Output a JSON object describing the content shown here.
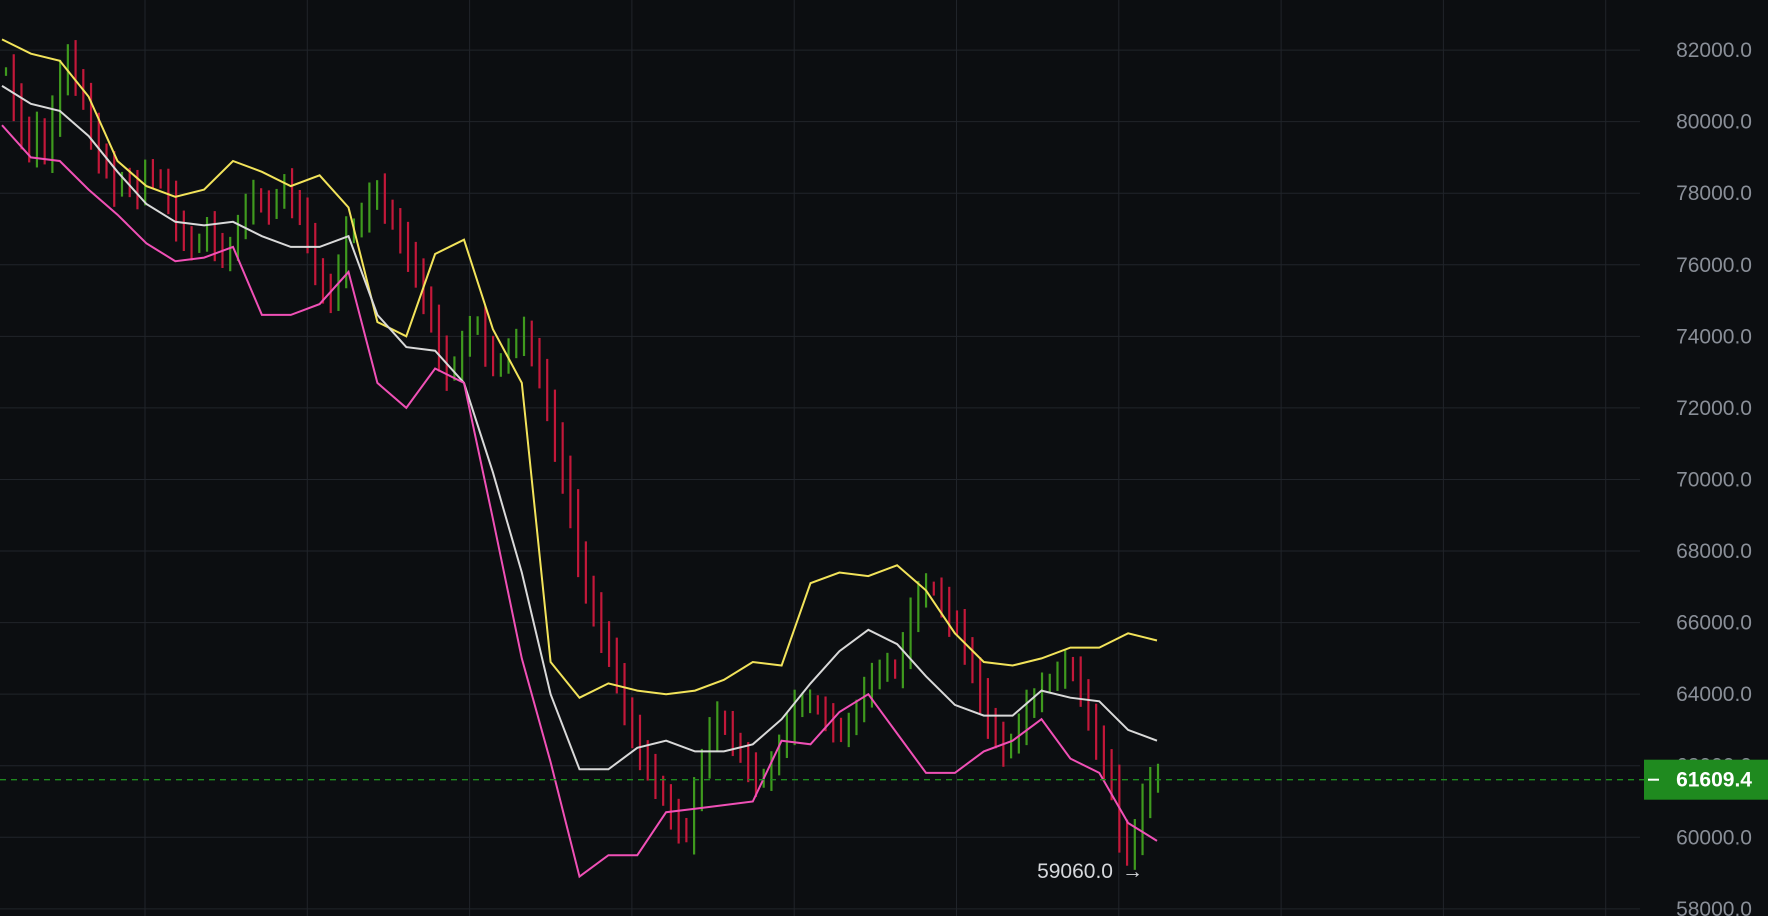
{
  "chart_data": {
    "type": "line",
    "subtype": "ohlc-bars-with-bollinger-bands",
    "y_axis_ticks": [
      "82000.0",
      "80000.0",
      "78000.0",
      "76000.0",
      "74000.0",
      "72000.0",
      "70000.0",
      "68000.0",
      "66000.0",
      "64000.0",
      "62000.0",
      "60000.0",
      "58000.0"
    ],
    "y_axis_side": "right",
    "ylim": [
      57800,
      83400
    ],
    "grid": true,
    "current_price": {
      "label": "61609.4",
      "value": 61609.4,
      "color": "#1f8a1f",
      "line_style": "dashed"
    },
    "low_annotation": {
      "label": "59060.0",
      "arrow": "→",
      "value": 59060.0
    },
    "colors": {
      "up_bar": "#3f9a1e",
      "down_bar": "#c3183a",
      "upper_band": "#f2e35a",
      "middle_band": "#d9d9d9",
      "lower_band": "#f050b6",
      "grid": "#20242a",
      "background": "#0c0e11"
    },
    "bars_count": 230,
    "bars_close": [
      81400,
      80500,
      79800,
      79200,
      79800,
      79100,
      80200,
      81100,
      81800,
      81200,
      80600,
      79700,
      79100,
      78700,
      78100,
      78400,
      78200,
      78000,
      78600,
      78500,
      78300,
      77800,
      77200,
      76700,
      76500,
      76700,
      77000,
      76600,
      76200,
      76400,
      77100,
      77600,
      77900,
      77700,
      77500,
      77900,
      78200,
      77800,
      77400,
      76800,
      75800,
      75300,
      75100,
      75900,
      76800,
      77100,
      77400,
      77800,
      78100,
      77600,
      77200,
      76700,
      76300,
      75700,
      75100,
      74400,
      73500,
      73000,
      73200,
      73700,
      74300,
      74300,
      73700,
      73200,
      73200,
      73700,
      73900,
      74100,
      73500,
      73000,
      72000,
      71000,
      70200,
      69100,
      67900,
      66900,
      66300,
      65700,
      65100,
      64500,
      63500,
      62900,
      62400,
      61900,
      61500,
      61100,
      60600,
      60300,
      60100,
      61100,
      62100,
      62900,
      63300,
      63100,
      62700,
      62300,
      61900,
      61600,
      61700,
      62000,
      62600,
      63100,
      63600,
      63800,
      63800,
      63600,
      63300,
      63100,
      62900,
      63100,
      63600,
      64100,
      64400,
      64700,
      64800,
      64600,
      65300,
      66100,
      66800,
      67000,
      66900,
      66500,
      66100,
      65900,
      65300,
      64600,
      63900,
      63300,
      62800,
      62400,
      62700,
      63100,
      63600,
      63900,
      64200,
      64400,
      64600,
      64800,
      64600,
      64100,
      63300,
      62600,
      62100,
      61400,
      60200,
      59500,
      60100,
      60900,
      61600,
      61700
    ],
    "series": [
      {
        "values": [
          82300,
          81900,
          81700,
          80700,
          78900,
          78200,
          77900,
          78100,
          78900,
          78600,
          78200,
          78500,
          77600,
          74400,
          74000,
          76300,
          76700,
          74200,
          72700,
          64900,
          63900,
          64300,
          64100,
          64000,
          64100,
          64400,
          64900,
          64800,
          67100,
          67400,
          67300,
          67600,
          66900,
          65700,
          64900,
          64800,
          65000,
          65300,
          65300,
          65700,
          65500
        ]
      },
      {
        "values": [
          81000,
          80500,
          80300,
          79600,
          78600,
          77700,
          77200,
          77100,
          77200,
          76800,
          76500,
          76500,
          76800,
          74600,
          73700,
          73600,
          72700,
          70200,
          67400,
          64000,
          61900,
          61900,
          62500,
          62700,
          62400,
          62400,
          62600,
          63300,
          64300,
          65200,
          65800,
          65400,
          64500,
          63700,
          63400,
          63400,
          64100,
          63900,
          63800,
          63000,
          62700
        ]
      },
      {
        "values": [
          79900,
          79000,
          78900,
          78100,
          77400,
          76600,
          76100,
          76200,
          76500,
          74600,
          74600,
          74900,
          75800,
          72700,
          72000,
          73100,
          72700,
          68900,
          65000,
          62100,
          58900,
          59500,
          59500,
          60700,
          60800,
          60900,
          61000,
          62700,
          62600,
          63500,
          64000,
          62900,
          61800,
          61800,
          62400,
          62700,
          63300,
          62200,
          61800,
          60400,
          59900
        ]
      }
    ]
  }
}
